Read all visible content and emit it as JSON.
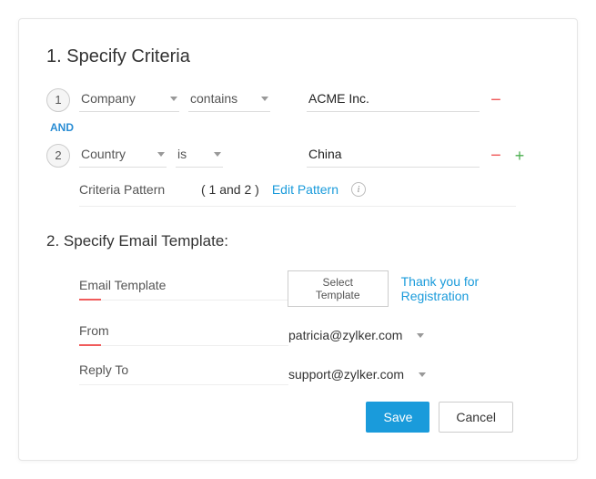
{
  "section1": {
    "title": "1. Specify Criteria",
    "rows": [
      {
        "num": "1",
        "field": "Company",
        "op": "contains",
        "value": "ACME Inc."
      },
      {
        "num": "2",
        "field": "Country",
        "op": "is",
        "value": "China"
      }
    ],
    "joiner": "AND",
    "pattern_label": "Criteria Pattern",
    "pattern_value": "( 1 and 2 )",
    "edit_pattern": "Edit Pattern"
  },
  "section2": {
    "title": "2. Specify Email Template:",
    "template_label": "Email Template",
    "select_btn": "Select Template",
    "template_name": "Thank you for Registration",
    "from_label": "From",
    "from_value": "patricia@zylker.com",
    "reply_label": "Reply To",
    "reply_value": "support@zylker.com"
  },
  "actions": {
    "save": "Save",
    "cancel": "Cancel"
  }
}
